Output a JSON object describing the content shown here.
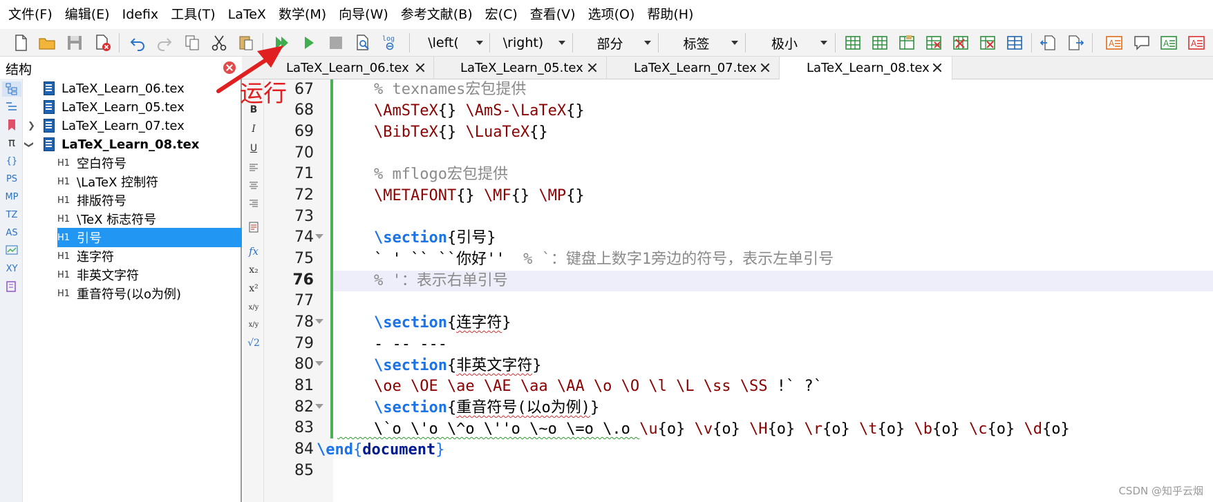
{
  "menu": [
    "文件(F)",
    "编辑(E)",
    "Idefix",
    "工具(T)",
    "LaTeX",
    "数学(M)",
    "向导(W)",
    "参考文献(B)",
    "宏(C)",
    "查看(V)",
    "选项(O)",
    "帮助(H)"
  ],
  "toolbar": {
    "left_combo": "\\left(",
    "right_combo": "\\right)",
    "part_combo": "部分",
    "label_combo": "标签",
    "size_combo": "极小",
    "log_label": "log"
  },
  "structure": {
    "title": "结构",
    "files": [
      "LaTeX_Learn_06.tex",
      "LaTeX_Learn_05.tex",
      "LaTeX_Learn_07.tex",
      "LaTeX_Learn_08.tex"
    ],
    "sections": [
      "空白符号",
      "\\LaTeX 控制符",
      "排版符号",
      "\\TeX 标志符号",
      "引号",
      "连字符",
      "非英文字符",
      "重音符号(以o为例)"
    ],
    "selected_section": "引号",
    "heading_icon": "H1"
  },
  "side_icons": [
    "structure-icon",
    "toc-icon",
    "bookmark-icon",
    "π",
    "{}",
    "PS",
    "MP",
    "TZ",
    "AS",
    "chart-icon",
    "XY",
    "macro-icon"
  ],
  "format_icons": [
    "B",
    "I",
    "U",
    "align-left",
    "align-center",
    "align-right",
    "template",
    "fx",
    "x₂",
    "x²",
    "x/y",
    "x/y",
    "√2"
  ],
  "tabs": [
    "LaTeX_Learn_06.tex",
    "LaTeX_Learn_05.tex",
    "LaTeX_Learn_07.tex",
    "LaTeX_Learn_08.tex"
  ],
  "active_tab": "LaTeX_Learn_08.tex",
  "editor": {
    "line_numbers": [
      "67",
      "68",
      "69",
      "70",
      "71",
      "72",
      "73",
      "74",
      "75",
      "76",
      "77",
      "78",
      "79",
      "80",
      "81",
      "82",
      "83",
      "84",
      "85"
    ],
    "current_line": "76",
    "lines": {
      "l67": "    % texnames宏包提供",
      "l68a": "    \\AmSTeX",
      "l68b": "{} ",
      "l68c": "\\AmS-\\LaTeX",
      "l68d": "{}",
      "l69a": "    \\BibTeX",
      "l69b": "{} ",
      "l69c": "\\LuaTeX",
      "l69d": "{}",
      "l71": "    % mflogo宏包提供",
      "l72a": "    \\METAFONT",
      "l72b": "{} ",
      "l72c": "\\MF",
      "l72d": "{} ",
      "l72e": "\\MP",
      "l72f": "{}",
      "l74a": "    \\section",
      "l74b": "{引号}",
      "l75a": "    ` ' `` ``你好''  ",
      "l75b": "% `：键盘上数字1旁边的符号，表示左单引号",
      "l76": "    % '：表示右单引号",
      "l78a": "    \\section",
      "l78b": "{",
      "l78c": "连字符",
      "l78d": "}",
      "l79": "    - -- ---",
      "l80a": "    \\section",
      "l80b": "{",
      "l80c": "非英文字符",
      "l80d": "}",
      "l81a": "    \\oe \\OE \\ae \\AE \\aa \\AA \\o \\O \\l \\L \\ss \\SS ",
      "l81b": "!` ?`",
      "l82a": "    \\section",
      "l82b": "{",
      "l82c": "重音符号(以o为例)",
      "l82d": "}",
      "l83a": "    \\`o \\'o \\^o \\''o \\~o \\=o \\.o ",
      "l83b": "\\u",
      "l83c": "{o} ",
      "l83d": "\\v",
      "l83e": "{o} ",
      "l83f": "\\H",
      "l83g": "{o} ",
      "l83h": "\\r",
      "l83i": "{o} ",
      "l83j": "\\t",
      "l83k": "{o} ",
      "l83l": "\\b",
      "l83m": "{o} ",
      "l83n": "\\c",
      "l83o": "{o} ",
      "l83p": "\\d",
      "l83q": "{o}",
      "l84a": "\\end",
      "l84b": "{",
      "l84c": "document",
      "l84d": "}"
    }
  },
  "annotation": {
    "label": "运行",
    "color": "#e02020"
  },
  "watermark": "CSDN @知乎云烟",
  "colors": {
    "selection": "#2196f3",
    "current_line": "#eeeefa",
    "change_bar": "#4caf50",
    "comment": "#8a8a8a",
    "command": "#8b0000",
    "section": "#1a73e8"
  }
}
